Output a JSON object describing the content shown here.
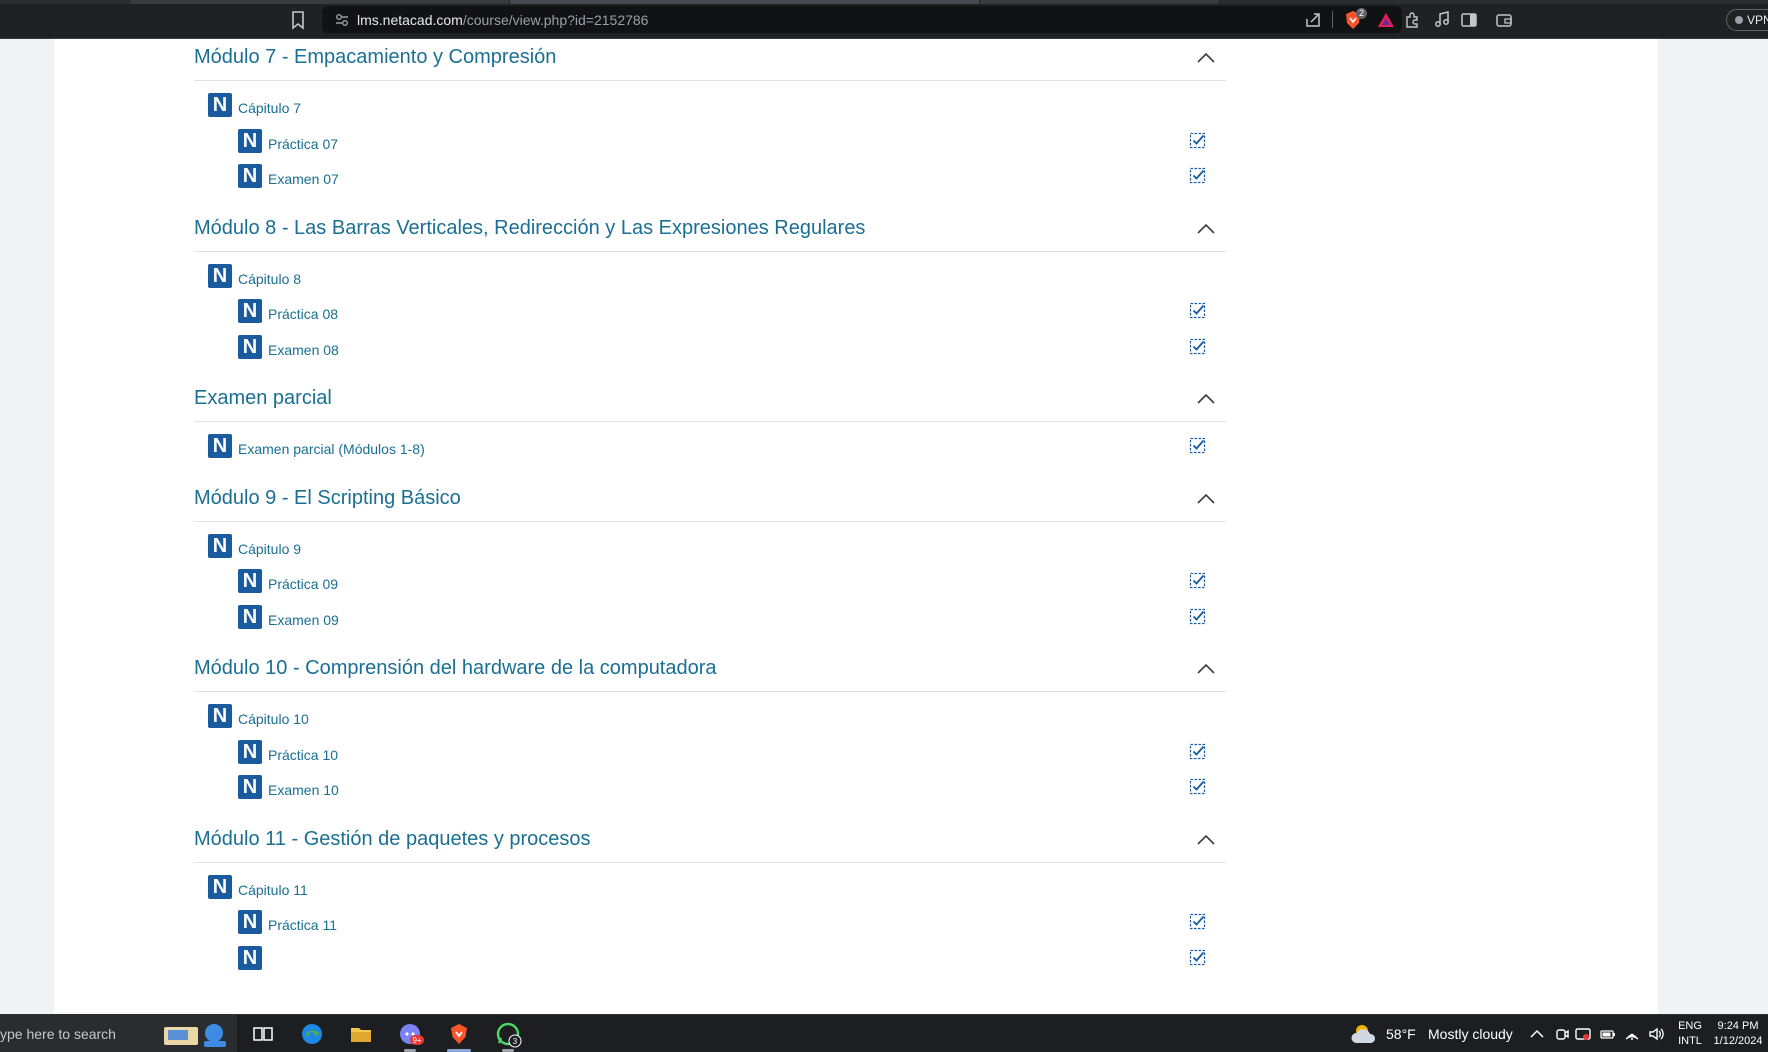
{
  "browser": {
    "url_host": "lms.netacad.com",
    "url_path": "/course/view.php?id=2152786",
    "shields_count": "2",
    "vpn_label": "VPN"
  },
  "course": {
    "sections": [
      {
        "title": "Módulo 7 - Empacamiento y Compresión",
        "activities": [
          {
            "label": "Cápitulo 7",
            "level": 0,
            "completion": false
          },
          {
            "label": "Práctica 07",
            "level": 1,
            "completion": true
          },
          {
            "label": "Examen 07",
            "level": 1,
            "completion": true
          }
        ]
      },
      {
        "title": "Módulo 8 - Las Barras Verticales, Redirección y Las Expresiones Regulares",
        "activities": [
          {
            "label": "Cápitulo 8",
            "level": 0,
            "completion": false
          },
          {
            "label": "Práctica 08",
            "level": 1,
            "completion": true
          },
          {
            "label": "Examen 08",
            "level": 1,
            "completion": true
          }
        ]
      },
      {
        "title": "Examen parcial",
        "activities": [
          {
            "label": "Examen parcial (Módulos 1-8)",
            "level": 0,
            "completion": true
          }
        ]
      },
      {
        "title": "Módulo 9 - El Scripting Básico",
        "activities": [
          {
            "label": "Cápitulo 9",
            "level": 0,
            "completion": false
          },
          {
            "label": "Práctica 09",
            "level": 1,
            "completion": true
          },
          {
            "label": "Examen 09",
            "level": 1,
            "completion": true
          }
        ]
      },
      {
        "title": "Módulo 10 - Comprensión del hardware de la computadora",
        "activities": [
          {
            "label": "Cápitulo 10",
            "level": 0,
            "completion": false
          },
          {
            "label": "Práctica 10",
            "level": 1,
            "completion": true
          },
          {
            "label": "Examen 10",
            "level": 1,
            "completion": true
          }
        ]
      },
      {
        "title": "Módulo 11 - Gestión de paquetes y procesos",
        "activities": [
          {
            "label": "Cápitulo 11",
            "level": 0,
            "completion": false
          },
          {
            "label": "Práctica 11",
            "level": 1,
            "completion": true
          },
          {
            "label": "",
            "level": 1,
            "completion": true
          }
        ]
      }
    ],
    "activity_icon_letter": "N"
  },
  "taskbar": {
    "search_text": "ype here to search",
    "apps": [
      "task-view",
      "edge",
      "file-explorer",
      "discord",
      "brave",
      "whatsapp"
    ],
    "discord_badge": "9+",
    "whatsapp_badge": "3",
    "weather_temp": "58°F",
    "weather_condition": "Mostly cloudy",
    "lang_line1": "ENG",
    "lang_line2": "INTL",
    "time": "9:24 PM",
    "date": "1/12/2024"
  },
  "colors": {
    "link": "#1a6f93",
    "icon_blue": "#1a5a9e",
    "taskbar": "#1c1e22"
  }
}
